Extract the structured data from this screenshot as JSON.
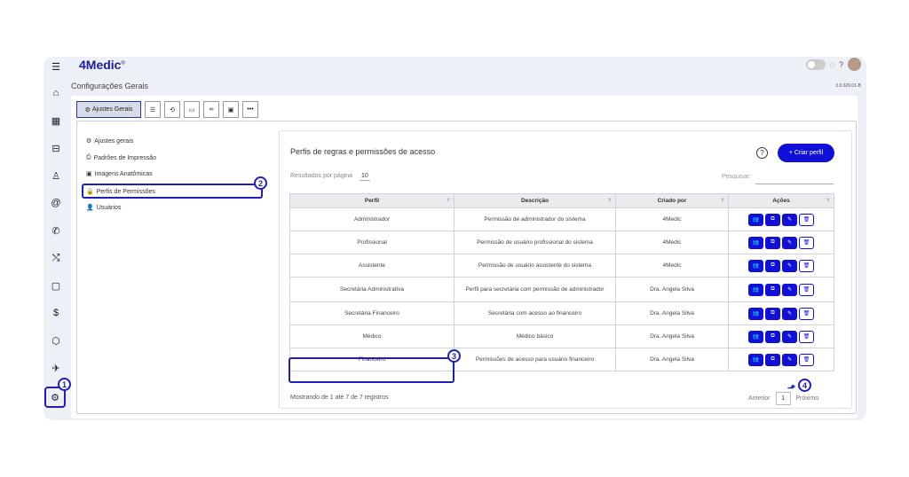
{
  "app": {
    "logo": "4Medic",
    "logo_mark": "©",
    "page_title": "Configurações Gerais",
    "version": "3.0.629.01-B"
  },
  "sidebar": {
    "icons": [
      "menu-icon",
      "home-icon",
      "calendar-icon",
      "inbox-icon",
      "user-icon",
      "at-icon",
      "phone-icon",
      "shuffle-icon",
      "clipboard-icon",
      "dollar-icon",
      "cube-icon",
      "plane-icon",
      "gear-icon"
    ]
  },
  "tabs": [
    {
      "label": "Ajustes Gerais",
      "icon": "gears-icon"
    },
    {
      "label": "☰",
      "icon": "list-icon"
    },
    {
      "label": "⟲",
      "icon": "history-icon"
    },
    {
      "label": "▭",
      "icon": "window-icon"
    },
    {
      "label": "∞",
      "icon": "link-icon"
    },
    {
      "label": "▣",
      "icon": "document-icon"
    },
    {
      "label": "•••",
      "icon": "more-icon"
    }
  ],
  "menu": [
    {
      "label": "Ajustes gerais",
      "icon": "⚙"
    },
    {
      "label": "Padrões de Impressão",
      "icon": "⎙"
    },
    {
      "label": "Imagens Anatômicas",
      "icon": "▣"
    },
    {
      "label": "Perfis de Permissões",
      "icon": "🔒"
    },
    {
      "label": "Usuários",
      "icon": "👤"
    }
  ],
  "badges": [
    "1",
    "2",
    "3",
    "4"
  ],
  "card": {
    "title": "Perfis de regras e permissões de acesso",
    "help": "?",
    "create_button": "+ Criar perfil",
    "rpp_label": "Resultados por página",
    "rpp_value": "10",
    "search_label": "Pesquisar:",
    "columns": [
      "Perfil",
      "Descrição",
      "Criado por",
      "Ações"
    ],
    "sort_glyph": "⇕",
    "rows": [
      {
        "perfil": "Administrador",
        "descricao": "Permissão de administrador do sistema",
        "criado_por": "4Medic"
      },
      {
        "perfil": "Profissional",
        "descricao": "Permissão de usuário profissional do sistema",
        "criado_por": "4Medic"
      },
      {
        "perfil": "Assistente",
        "descricao": "Permissão de usuário assistente do sistema",
        "criado_por": "4Medic"
      },
      {
        "perfil": "Secretária Administrativa",
        "descricao": "Perfil para secretária com permissão de administrador",
        "criado_por": "Dra. Angela Silva"
      },
      {
        "perfil": "Secretária Financeiro",
        "descricao": "Secretária com acesso ao financeiro",
        "criado_por": "Dra. Angela Silva"
      },
      {
        "perfil": "Médico",
        "descricao": "Médico básico",
        "criado_por": "Dra. Angela Silva"
      },
      {
        "perfil": "Financeiro",
        "descricao": "Permissões de acesso para usuário financeiro",
        "criado_por": "Dra. Angela Silva"
      }
    ],
    "action_glyphs": {
      "users": "👥",
      "copy": "⧉",
      "edit": "✎",
      "delete": "🗑"
    },
    "showing": "Mostrando de 1 até 7 de 7 registros",
    "prev": "Anterior",
    "page": "1",
    "next": "Próximo"
  }
}
